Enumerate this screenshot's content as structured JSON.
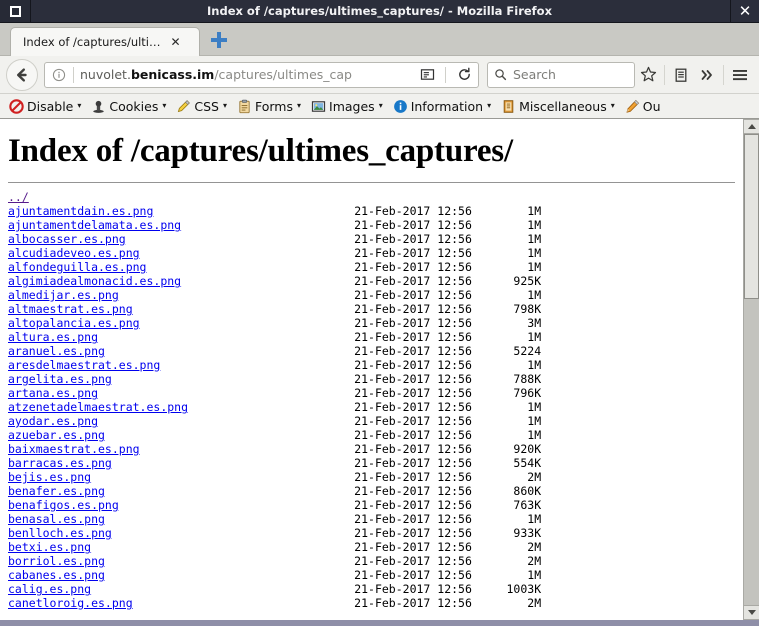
{
  "window": {
    "title": "Index of /captures/ultimes_captures/ - Mozilla Firefox",
    "restore_icon": "window-restore-icon",
    "close_label": "✕"
  },
  "tabs": {
    "items": [
      {
        "label": "Index of /captures/ulti…",
        "close_label": "✕"
      }
    ],
    "new_tab_label": "+"
  },
  "navbar": {
    "back_label": "←",
    "identity_icon": "info-circle-icon",
    "url_prefix": "nuvolet.",
    "url_host": "benicass.im",
    "url_path": "/captures/ultimes_cap",
    "reader_icon": "reader-mode-icon",
    "reload_label": "↻",
    "search_placeholder": "Search",
    "search_value": "",
    "bookmark_label": "☆",
    "library_icon": "library-icon",
    "overflow_label": "»",
    "menu_label": "hamburger-menu-icon"
  },
  "devtoolbar": {
    "items": [
      {
        "label": "Disable",
        "icon": "disable-icon",
        "caret": "▾"
      },
      {
        "label": "Cookies",
        "icon": "cookies-icon",
        "caret": "▾"
      },
      {
        "label": "CSS",
        "icon": "css-icon",
        "caret": "▾"
      },
      {
        "label": "Forms",
        "icon": "forms-icon",
        "caret": "▾"
      },
      {
        "label": "Images",
        "icon": "images-icon",
        "caret": "▾"
      },
      {
        "label": "Information",
        "icon": "information-icon",
        "caret": "▾"
      },
      {
        "label": "Miscellaneous",
        "icon": "miscellaneous-icon",
        "caret": "▾"
      },
      {
        "label": "Ou",
        "icon": "outline-icon",
        "caret": ""
      }
    ]
  },
  "page": {
    "heading": "Index of /captures/ultimes_captures/",
    "parent_link": "../",
    "timestamp": "21-Feb-2017 12:56",
    "entries": [
      {
        "name": "ajuntamentdain.es.png",
        "date": "21-Feb-2017 12:56",
        "size": "1M"
      },
      {
        "name": "ajuntamentdelamata.es.png",
        "date": "21-Feb-2017 12:56",
        "size": "1M"
      },
      {
        "name": "albocasser.es.png",
        "date": "21-Feb-2017 12:56",
        "size": "1M"
      },
      {
        "name": "alcudiadeveo.es.png",
        "date": "21-Feb-2017 12:56",
        "size": "1M"
      },
      {
        "name": "alfondeguilla.es.png",
        "date": "21-Feb-2017 12:56",
        "size": "1M"
      },
      {
        "name": "algimiadealmonacid.es.png",
        "date": "21-Feb-2017 12:56",
        "size": "925K"
      },
      {
        "name": "almedijar.es.png",
        "date": "21-Feb-2017 12:56",
        "size": "1M"
      },
      {
        "name": "altmaestrat.es.png",
        "date": "21-Feb-2017 12:56",
        "size": "798K"
      },
      {
        "name": "altopalancia.es.png",
        "date": "21-Feb-2017 12:56",
        "size": "3M"
      },
      {
        "name": "altura.es.png",
        "date": "21-Feb-2017 12:56",
        "size": "1M"
      },
      {
        "name": "aranuel.es.png",
        "date": "21-Feb-2017 12:56",
        "size": "5224"
      },
      {
        "name": "aresdelmaestrat.es.png",
        "date": "21-Feb-2017 12:56",
        "size": "1M"
      },
      {
        "name": "argelita.es.png",
        "date": "21-Feb-2017 12:56",
        "size": "788K"
      },
      {
        "name": "artana.es.png",
        "date": "21-Feb-2017 12:56",
        "size": "796K"
      },
      {
        "name": "atzenetadelmaestrat.es.png",
        "date": "21-Feb-2017 12:56",
        "size": "1M"
      },
      {
        "name": "ayodar.es.png",
        "date": "21-Feb-2017 12:56",
        "size": "1M"
      },
      {
        "name": "azuebar.es.png",
        "date": "21-Feb-2017 12:56",
        "size": "1M"
      },
      {
        "name": "baixmaestrat.es.png",
        "date": "21-Feb-2017 12:56",
        "size": "920K"
      },
      {
        "name": "barracas.es.png",
        "date": "21-Feb-2017 12:56",
        "size": "554K"
      },
      {
        "name": "bejis.es.png",
        "date": "21-Feb-2017 12:56",
        "size": "2M"
      },
      {
        "name": "benafer.es.png",
        "date": "21-Feb-2017 12:56",
        "size": "860K"
      },
      {
        "name": "benafigos.es.png",
        "date": "21-Feb-2017 12:56",
        "size": "763K"
      },
      {
        "name": "benasal.es.png",
        "date": "21-Feb-2017 12:56",
        "size": "1M"
      },
      {
        "name": "benlloch.es.png",
        "date": "21-Feb-2017 12:56",
        "size": "933K"
      },
      {
        "name": "betxi.es.png",
        "date": "21-Feb-2017 12:56",
        "size": "2M"
      },
      {
        "name": "borriol.es.png",
        "date": "21-Feb-2017 12:56",
        "size": "2M"
      },
      {
        "name": "cabanes.es.png",
        "date": "21-Feb-2017 12:56",
        "size": "1M"
      },
      {
        "name": "calig.es.png",
        "date": "21-Feb-2017 12:56",
        "size": "1003K"
      },
      {
        "name": "canetloroig.es.png",
        "date": "21-Feb-2017 12:56",
        "size": "2M"
      }
    ]
  },
  "scrollbar": {
    "up_label": "▲",
    "down_label": "▼"
  },
  "colors": {
    "titlebar": "#2b2e3b",
    "chrome": "#f1f1ee",
    "link": "#0000ee",
    "visited_link": "#551a8b",
    "tabstrip": "#c9c9c4"
  }
}
